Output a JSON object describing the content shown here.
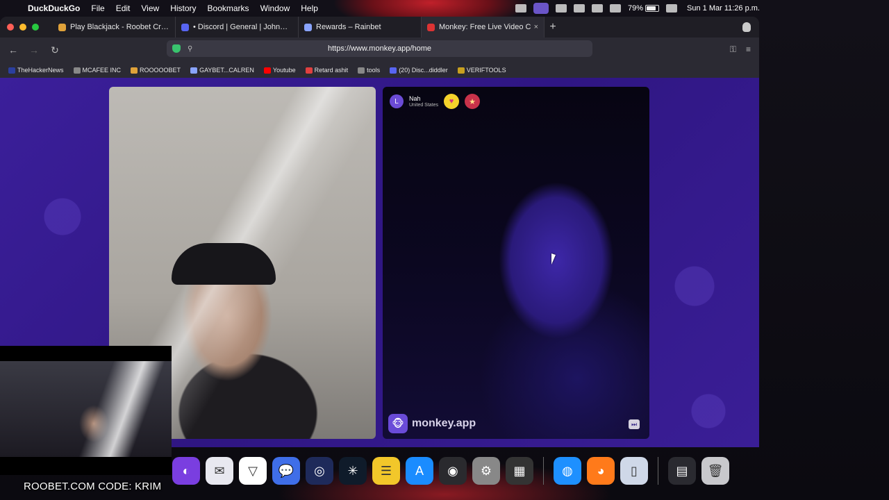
{
  "menubar": {
    "app_name": "DuckDuckGo",
    "menus": [
      "File",
      "Edit",
      "View",
      "History",
      "Bookmarks",
      "Window",
      "Help"
    ],
    "battery": "79%",
    "clock": "Sun 1 Mar  11:26 p.m."
  },
  "tabs": [
    {
      "title": "Play Blackjack - Roobet Crypto (",
      "favicon_color": "#e0a23a"
    },
    {
      "title": "• Discord | General | JohnMcafe",
      "favicon_color": "#5865f2"
    },
    {
      "title": "Rewards – Rainbet",
      "favicon_color": "#8aa4ff"
    },
    {
      "title": "Monkey: Free Live Video C",
      "favicon_color": "#d33",
      "close": "×"
    }
  ],
  "toolbar": {
    "url": "https://www.monkey.app/home",
    "back": "←",
    "forward": "→",
    "reload": "↻",
    "key": "⚿",
    "menu": "≡",
    "new_tab": "+"
  },
  "bookmarks": [
    {
      "label": "TheHackerNews",
      "color": "#2b3f9e"
    },
    {
      "label": "MCAFEE INC",
      "color": "#888"
    },
    {
      "label": "ROOOOOBET",
      "color": "#e0a23a"
    },
    {
      "label": "GAYBET...CALREN",
      "color": "#8aa4ff"
    },
    {
      "label": "Youtube",
      "color": "#ff0000"
    },
    {
      "label": "Retard ashit",
      "color": "#e04040"
    },
    {
      "label": "tools",
      "color": "#888"
    },
    {
      "label": "(20) Disc...diddler",
      "color": "#5865f2"
    },
    {
      "label": "VERIFTOOLS",
      "color": "#c8a020"
    }
  ],
  "peer": {
    "avatar_letter": "L",
    "name": "Nah",
    "country": "United States",
    "heart": "♥",
    "gift": "★"
  },
  "brand": {
    "logo": "🐵",
    "text": "monkey.app",
    "skip": "⏭"
  },
  "stream_caption": "ROOBET.COM CODE: KRIM",
  "dock": [
    {
      "name": "arc",
      "color": "#7a3ee0",
      "glyph": "◐"
    },
    {
      "name": "mail",
      "color": "#e8e8f0",
      "glyph": "✉"
    },
    {
      "name": "vpn",
      "color": "#ffffff",
      "glyph": "▽"
    },
    {
      "name": "messages",
      "color": "#3f6ee8",
      "glyph": "💬"
    },
    {
      "name": "fingerprint",
      "color": "#1e2a5a",
      "glyph": "◎"
    },
    {
      "name": "perplexity",
      "color": "#0f1b2a",
      "glyph": "✳"
    },
    {
      "name": "notes",
      "color": "#f2c72a",
      "glyph": "☰"
    },
    {
      "name": "app-store",
      "color": "#1a8cff",
      "glyph": "A"
    },
    {
      "name": "obs",
      "color": "#2a2a2e",
      "glyph": "◉"
    },
    {
      "name": "settings",
      "color": "#888",
      "glyph": "⚙"
    },
    {
      "name": "launchpad",
      "color": "#333",
      "glyph": "▦"
    },
    {
      "name": "safari",
      "color": "#1e90ff",
      "glyph": "◍"
    },
    {
      "name": "firefox",
      "color": "#ff7a1a",
      "glyph": "◕"
    },
    {
      "name": "iphone-mirroring",
      "color": "#cfd8e8",
      "glyph": "▯"
    },
    {
      "name": "recent-window",
      "color": "#2a2a30",
      "glyph": "▤"
    },
    {
      "name": "trash",
      "color": "#c8c8cc",
      "glyph": "🗑"
    }
  ]
}
